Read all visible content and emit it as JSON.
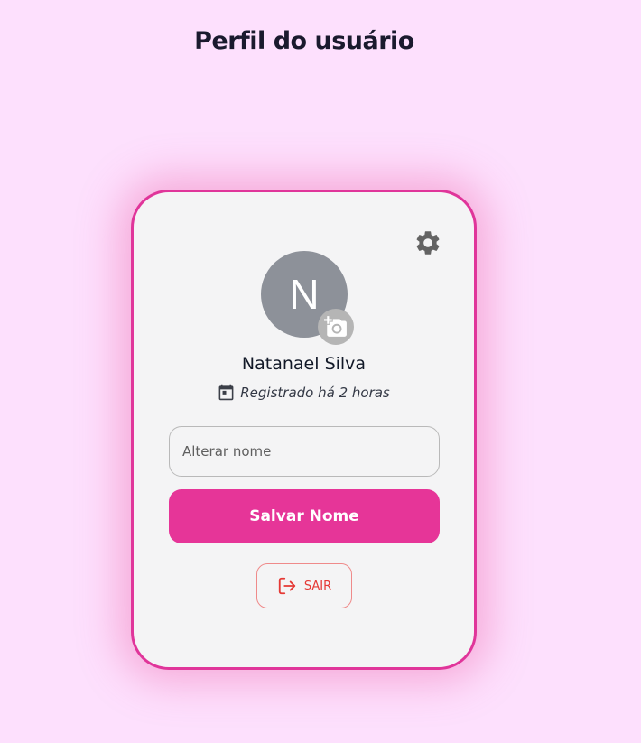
{
  "page": {
    "title": "Perfil do usuário"
  },
  "profile": {
    "avatar_initial": "N",
    "name": "Natanael Silva",
    "registered_text": "Registrado há 2 horas"
  },
  "form": {
    "name_placeholder": "Alterar nome",
    "name_value": "",
    "save_label": "Salvar Nome"
  },
  "actions": {
    "logout_label": "SAIR"
  },
  "icons": {
    "settings": "gear-icon",
    "camera": "camera-add-icon",
    "calendar": "calendar-icon",
    "logout": "logout-icon"
  },
  "colors": {
    "background": "#fde0fd",
    "accent": "#e63598",
    "card_border": "#e0359a",
    "logout": "#e53935",
    "avatar": "#8d9199"
  }
}
